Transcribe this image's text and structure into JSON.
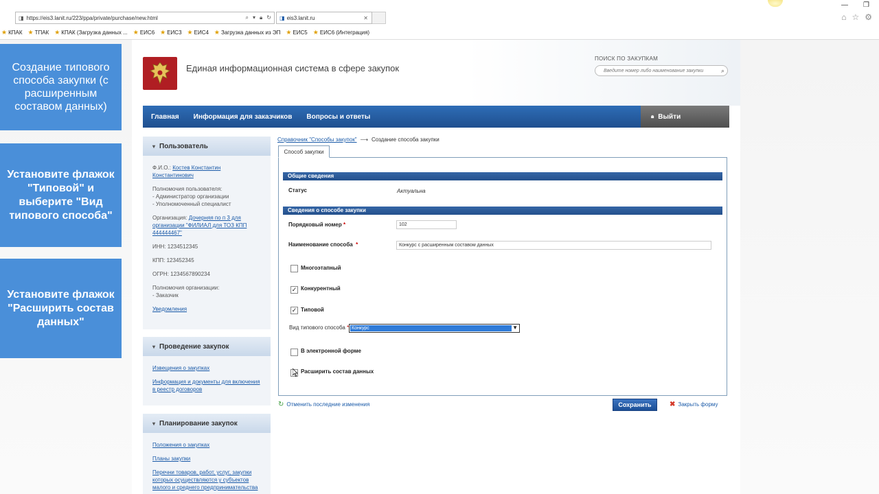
{
  "browser": {
    "url": "https://eis3.lanit.ru/223/ppa/private/purchase/new.html",
    "tab_title": "eis3.lanit.ru",
    "favorites": [
      "КПАК",
      "ТПАК",
      "КПАК (Загрузка данных ...",
      "ЕИС6",
      "ЕИС3",
      "ЕИС4",
      "Загрузка данных из ЭП",
      "ЕИС5",
      "ЕИС6 (Интеграция)"
    ]
  },
  "overlays": {
    "step1": "Создание типового\nспособа закупки (с\nрасширенным\nсоставом данных)",
    "step2": "Установите флажок\n\"Типовой\" и\nвыберите \"Вид\nтипового способа\"",
    "step3": "Установите флажок\n\"Расширить состав\nданных\""
  },
  "header": {
    "title": "Единая информационная система в сфере закупок",
    "search_label": "ПОИСК ПО ЗАКУПКАМ",
    "search_placeholder": "Введите номер либо наименование закупки"
  },
  "nav": {
    "items": [
      "Главная",
      "Информация для заказчиков",
      "Вопросы и ответы"
    ],
    "logout": "Выйти"
  },
  "sidebar": {
    "user": {
      "title": "Пользователь",
      "fio_label": "Ф.И.О.:",
      "fio": "Костев Константин Константинович",
      "powers_label": "Полномочия пользователя:",
      "powers": [
        "- Администратор организации",
        "- Уполномоченный специалист"
      ],
      "org_label": "Организация:",
      "org": "Дочерняя по п 3 для организации \"ФИЛИАЛ для ТОЗ КПП 444444467\"",
      "inn": "ИНН: 1234512345",
      "kpp": "КПП: 123452345",
      "ogrn": "ОГРН: 1234567890234",
      "org_powers_label": "Полномочия организации:",
      "org_powers": "- Заказчик",
      "notifications": "Уведомления"
    },
    "procurement": {
      "title": "Проведение закупок",
      "links": [
        "Извещения о закупках",
        "Информация и документы для включения в реестр договоров"
      ]
    },
    "planning": {
      "title": "Планирование закупок",
      "links": [
        "Положения о закупках",
        "Планы закупки",
        "Перечни товаров, работ, услуг, закупки которых осуществляются у субъектов малого и среднего предпринимательства"
      ]
    }
  },
  "main": {
    "breadcrumb_link": "Справочник \"Способы закупок\"",
    "breadcrumb_arrow": "⟶",
    "breadcrumb_current": "Создание способа закупки",
    "tab": "Способ закупки",
    "section_general": "Общие сведения",
    "status_label": "Статус",
    "status_value": "Актуальна",
    "section_method": "Сведения о способе закупки",
    "order_label": "Порядковый номер",
    "order_value": "102",
    "name_label": "Наименование способа",
    "name_value": "Конкурс с расширенным составом данных",
    "req_mark": "*",
    "cb_multistage": "Многоэтапный",
    "cb_competitive": "Конкурентный",
    "cb_typical": "Типовой",
    "type_label": "Вид типового способа",
    "type_value": "Конкурс",
    "cb_electronic": "В электронной форме",
    "cb_extend": "Расширить состав данных",
    "undo": "Отменить последние изменения",
    "save": "Сохранить",
    "close": "Закрыть форму",
    "checked": {
      "multistage": false,
      "competitive": true,
      "typical": true,
      "electronic": false,
      "extend": false
    }
  }
}
